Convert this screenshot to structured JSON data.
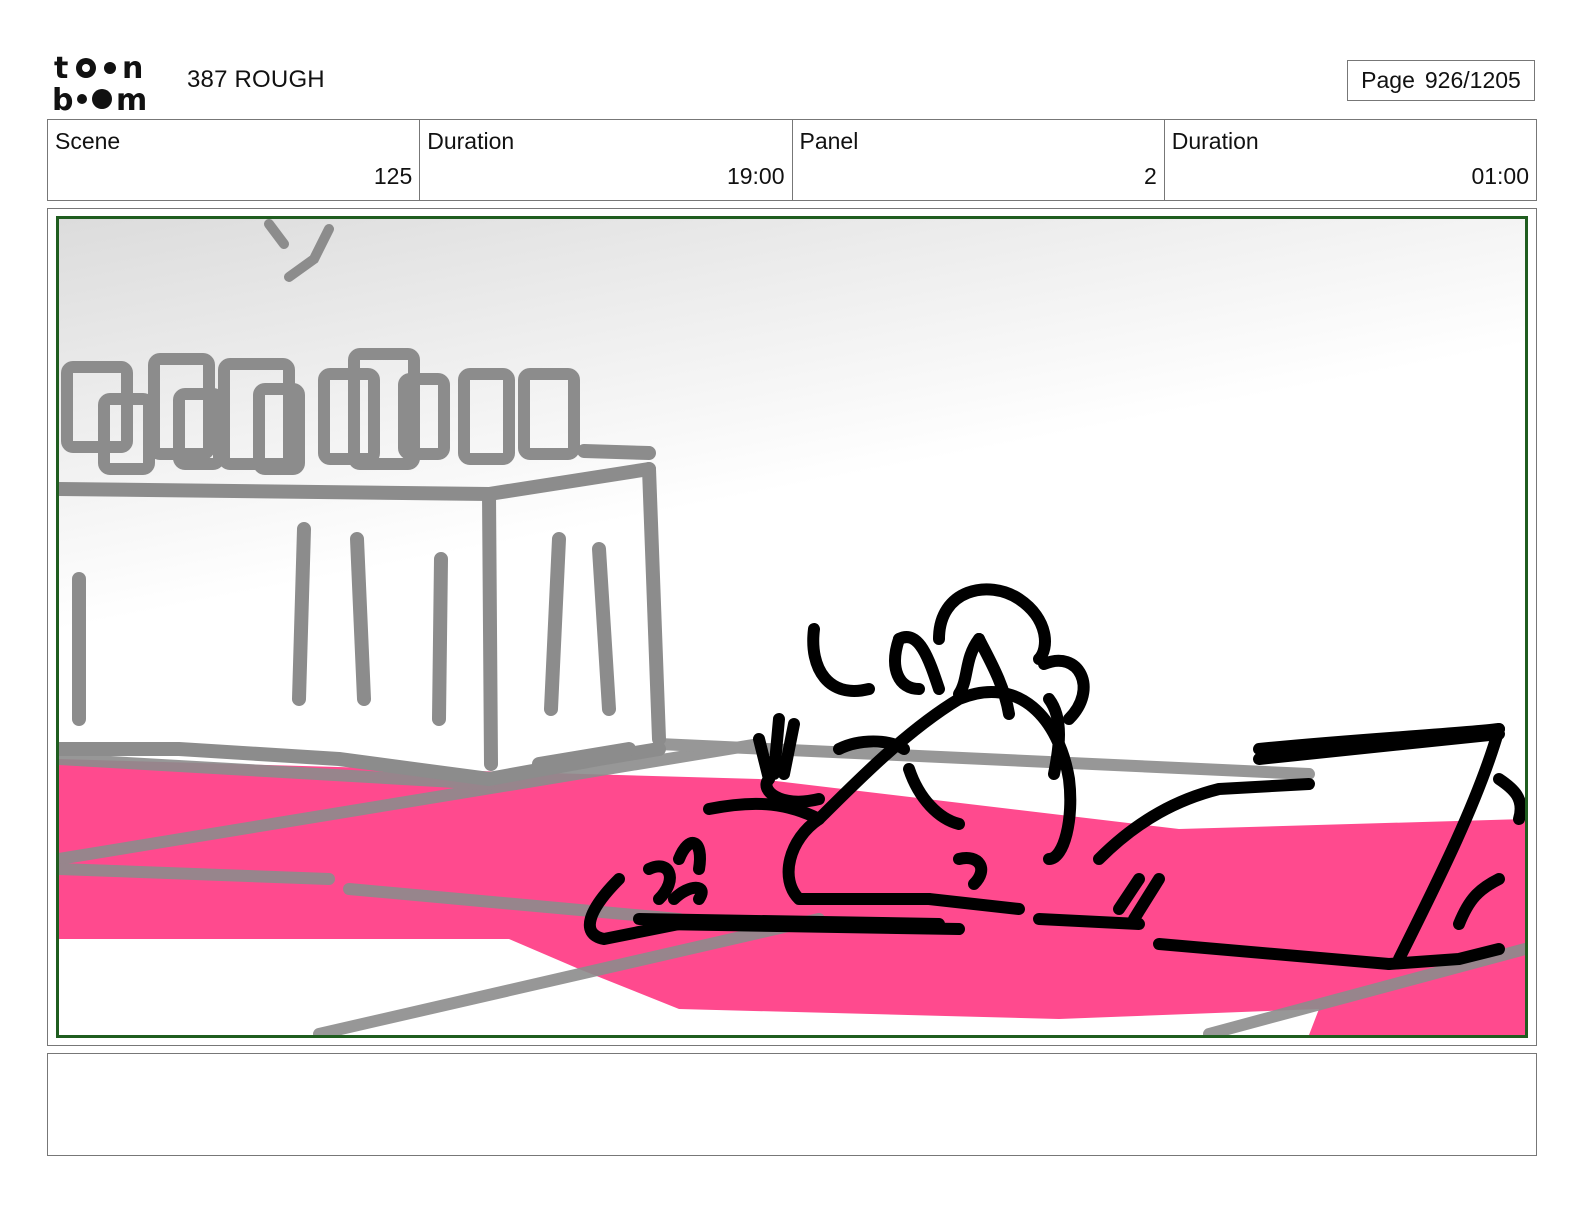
{
  "header": {
    "logo_top": "to●n",
    "logo_bottom": "b●●m",
    "title": "387 ROUGH",
    "page_label": "Page",
    "page_value": "926/1205"
  },
  "info": {
    "scene_label": "Scene",
    "scene_value": "125",
    "scene_duration_label": "Duration",
    "scene_duration_value": "19:00",
    "panel_label": "Panel",
    "panel_value": "2",
    "panel_duration_label": "Duration",
    "panel_duration_value": "01:00"
  },
  "colors": {
    "panel_border": "#1f5d1f",
    "carpet": "#ff4a8e",
    "sketch_grey": "#8c8c8c",
    "ink": "#000000"
  },
  "notes": {
    "text": ""
  }
}
